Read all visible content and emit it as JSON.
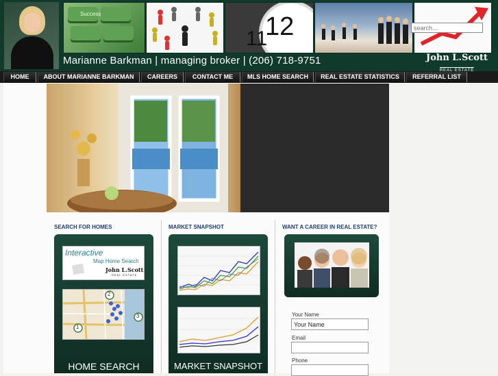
{
  "header": {
    "search_placeholder": "search...",
    "tagline": "Marianne Barkman | managing broker | (206) 718-9751",
    "keyboard_key_label": "Success",
    "clock_number": "12",
    "clock_number_left": "11",
    "logo_line1": "John L.Scott",
    "logo_line2": "REAL ESTATE"
  },
  "nav": {
    "items": [
      {
        "label": "HOME"
      },
      {
        "label": "ABOUT MARIANNE BARKMAN"
      },
      {
        "label": "CAREERS"
      },
      {
        "label": "CONTACT ME"
      },
      {
        "label": "MLS HOME SEARCH"
      },
      {
        "label": "REAL ESTATE STATISTICS"
      },
      {
        "label": "REFERRAL LIST"
      }
    ]
  },
  "columns": {
    "search_title": "SEARCH FOR HOMES",
    "market_title": "MARKET SNAPSHOT",
    "career_title": "WANT A CAREER IN REAL ESTATE?"
  },
  "search_panel": {
    "map_title_1": "Interactive",
    "map_title_2": "Map Home Search",
    "map_logo_1": "John L.Scott",
    "map_logo_2": "REAL ESTATE",
    "pin_labels": [
      "2",
      "1",
      "3"
    ],
    "button_label": "HOME SEARCH"
  },
  "market_panel": {
    "button_label": "MARKET SNAPSHOT"
  },
  "form": {
    "name_label": "Your Name",
    "name_value": "Your Name",
    "email_label": "Email",
    "email_value": "",
    "phone_label": "Phone",
    "phone_value": ""
  },
  "colors": {
    "header_green": "#0f3a2c",
    "nav_black": "#1a1a1a",
    "title_blue": "#1f3f6e"
  }
}
